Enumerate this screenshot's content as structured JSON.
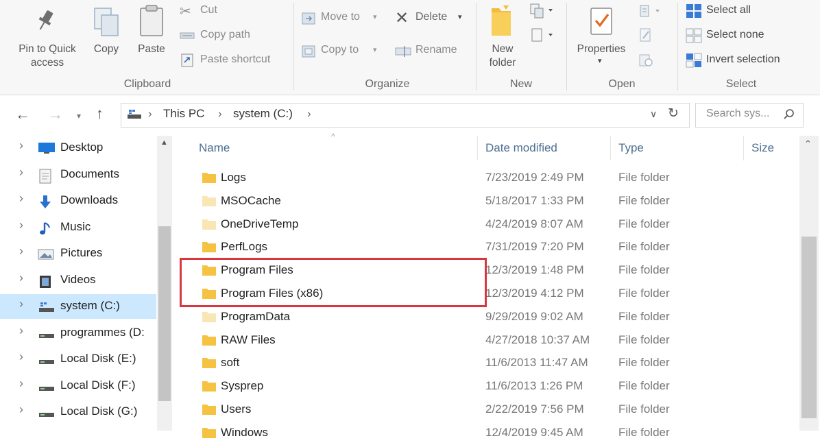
{
  "ribbon": {
    "clipboard": {
      "group_label": "Clipboard",
      "pin_label_line1": "Pin to Quick",
      "pin_label_line2": "access",
      "copy_label": "Copy",
      "paste_label": "Paste",
      "cut_label": "Cut",
      "copy_path_label": "Copy path",
      "paste_shortcut_label": "Paste shortcut"
    },
    "organize": {
      "group_label": "Organize",
      "move_to_label": "Move to",
      "delete_label": "Delete",
      "copy_to_label": "Copy to",
      "rename_label": "Rename"
    },
    "new": {
      "group_label": "New",
      "new_folder_line1": "New",
      "new_folder_line2": "folder"
    },
    "open": {
      "group_label": "Open",
      "properties_label": "Properties"
    },
    "select": {
      "group_label": "Select",
      "select_all_label": "Select all",
      "select_none_label": "Select none",
      "invert_selection_label": "Invert selection"
    }
  },
  "address_bar": {
    "crumbs": [
      "This PC",
      "system (C:)"
    ],
    "search_placeholder": "Search sys..."
  },
  "nav_pane": {
    "items": [
      {
        "label": "Desktop",
        "icon": "desktop-icon"
      },
      {
        "label": "Documents",
        "icon": "documents-icon"
      },
      {
        "label": "Downloads",
        "icon": "downloads-icon"
      },
      {
        "label": "Music",
        "icon": "music-icon"
      },
      {
        "label": "Pictures",
        "icon": "pictures-icon"
      },
      {
        "label": "Videos",
        "icon": "videos-icon"
      },
      {
        "label": "system (C:)",
        "icon": "system-drive-icon",
        "selected": true
      },
      {
        "label": "programmes (D:",
        "icon": "drive-icon"
      },
      {
        "label": "Local Disk (E:)",
        "icon": "drive-icon"
      },
      {
        "label": "Local Disk (F:)",
        "icon": "drive-icon"
      },
      {
        "label": "Local Disk (G:)",
        "icon": "drive-icon"
      }
    ]
  },
  "file_list": {
    "columns": {
      "name": "Name",
      "date": "Date modified",
      "type": "Type",
      "size": "Size"
    },
    "rows": [
      {
        "name": "Logs",
        "date": "7/23/2019 2:49 PM",
        "type": "File folder",
        "faded": false
      },
      {
        "name": "MSOCache",
        "date": "5/18/2017 1:33 PM",
        "type": "File folder",
        "faded": true
      },
      {
        "name": "OneDriveTemp",
        "date": "4/24/2019 8:07 AM",
        "type": "File folder",
        "faded": true
      },
      {
        "name": "PerfLogs",
        "date": "7/31/2019 7:20 PM",
        "type": "File folder",
        "faded": false
      },
      {
        "name": "Program Files",
        "date": "12/3/2019 1:48 PM",
        "type": "File folder",
        "faded": false
      },
      {
        "name": "Program Files (x86)",
        "date": "12/3/2019 4:12 PM",
        "type": "File folder",
        "faded": false
      },
      {
        "name": "ProgramData",
        "date": "9/29/2019 9:02 AM",
        "type": "File folder",
        "faded": true
      },
      {
        "name": "RAW Files",
        "date": "4/27/2018 10:37 AM",
        "type": "File folder",
        "faded": false
      },
      {
        "name": "soft",
        "date": "11/6/2013 11:47 AM",
        "type": "File folder",
        "faded": false
      },
      {
        "name": "Sysprep",
        "date": "11/6/2013 1:26 PM",
        "type": "File folder",
        "faded": false
      },
      {
        "name": "Users",
        "date": "2/22/2019 7:56 PM",
        "type": "File folder",
        "faded": false
      },
      {
        "name": "Windows",
        "date": "12/4/2019 9:45 AM",
        "type": "File folder",
        "faded": false
      }
    ]
  },
  "colors": {
    "folder": "#f5c242",
    "folder_faded": "#f8e7b4",
    "highlight": "#d9363e",
    "selected_nav": "#cce8ff",
    "header_text": "#4d6f91"
  }
}
